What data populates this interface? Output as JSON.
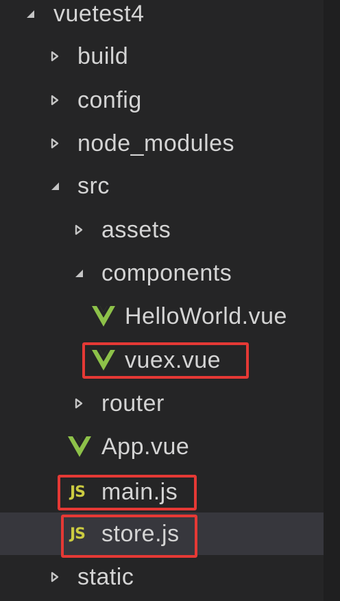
{
  "tree": {
    "root": {
      "label": "vuetest4",
      "expanded": true
    },
    "items": [
      {
        "label": "build",
        "type": "folder",
        "expanded": false
      },
      {
        "label": "config",
        "type": "folder",
        "expanded": false
      },
      {
        "label": "node_modules",
        "type": "folder",
        "expanded": false
      },
      {
        "label": "src",
        "type": "folder",
        "expanded": true
      },
      {
        "label": "assets",
        "type": "folder",
        "expanded": false
      },
      {
        "label": "components",
        "type": "folder",
        "expanded": true
      },
      {
        "label": "HelloWorld.vue",
        "type": "vue-file"
      },
      {
        "label": "vuex.vue",
        "type": "vue-file",
        "highlighted": true
      },
      {
        "label": "router",
        "type": "folder",
        "expanded": false
      },
      {
        "label": "App.vue",
        "type": "vue-file"
      },
      {
        "label": "main.js",
        "type": "js-file",
        "highlighted": true
      },
      {
        "label": "store.js",
        "type": "js-file",
        "highlighted": true,
        "selected": true
      },
      {
        "label": "static",
        "type": "folder",
        "expanded": false
      }
    ]
  },
  "icons": {
    "js_badge": "JS",
    "vue": "vue-icon",
    "collapsed": "chevron-right-icon",
    "expanded": "chevron-down-icon"
  },
  "colors": {
    "background": "#252526",
    "selected_row": "#37373d",
    "text": "#d4d4d4",
    "vue_green": "#8dc149",
    "js_yellow": "#cbcb41",
    "highlight_red": "#e53935"
  }
}
